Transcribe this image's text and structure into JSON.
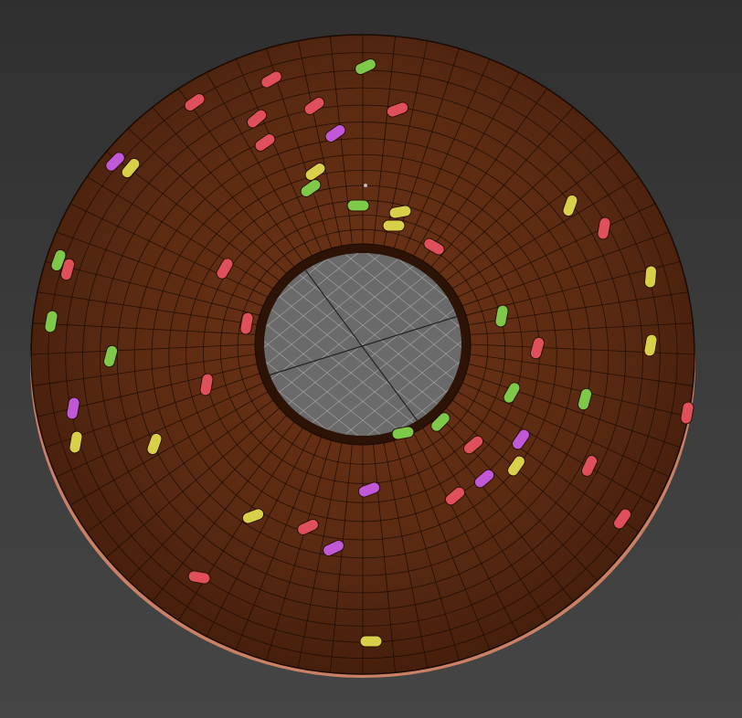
{
  "viewport": {
    "name": "3d-perspective-viewport",
    "background": "#3b3b3b"
  },
  "donut": {
    "name": "donut-model",
    "icing_color": "#5a2a12",
    "icing_dark": "#3e1b0a",
    "dough_color": "#d58a6b",
    "wire_color": "#1a0a03",
    "hole_floor_color": "#6a6a6a",
    "grid_color": "#9a9a9a"
  },
  "sprinkles": {
    "colors": [
      "#e0505a",
      "#7ec84a",
      "#d8d048",
      "#c058d8"
    ]
  }
}
